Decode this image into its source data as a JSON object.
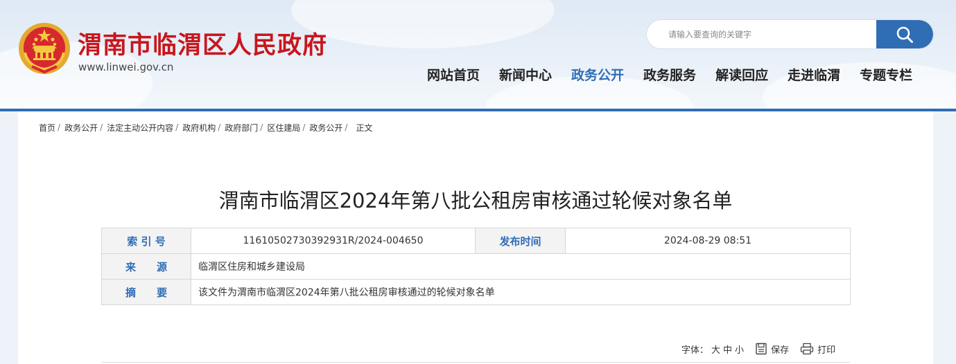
{
  "header": {
    "site_title": "渭南市临渭区人民政府",
    "site_url": "www.linwei.gov.cn",
    "search_placeholder": "请输入要查询的关键字"
  },
  "nav": {
    "items": [
      "网站首页",
      "新闻中心",
      "政务公开",
      "政务服务",
      "解读回应",
      "走进临渭",
      "专题专栏"
    ],
    "active": "政务公开"
  },
  "breadcrumb": {
    "items": [
      "首页",
      "政务公开",
      "法定主动公开内容",
      "政府机构",
      "政府部门",
      "区住建局",
      "政务公开",
      "正文"
    ],
    "separator": "/"
  },
  "article": {
    "title": "渭南市临渭区2024年第八批公租房审核通过轮候对象名单",
    "meta": {
      "index_label": "索 引 号",
      "index_value": "11610502730392931R/2024-004650",
      "date_label": "发布时间",
      "date_value": "2024-08-29 08:51",
      "source_label": "来　　源",
      "source_value": "临渭区住房和城乡建设局",
      "abstract_label": "摘　　要",
      "abstract_value": "该文件为渭南市临渭区2024年第八批公租房审核通过的轮候对象名单"
    }
  },
  "tools": {
    "font_label": "字体：",
    "size_large": "大",
    "size_medium": "中",
    "size_small": "小",
    "save_label": "保存",
    "print_label": "打印"
  },
  "colors": {
    "brand_red": "#c8161d",
    "accent_blue": "#2f6db5"
  }
}
